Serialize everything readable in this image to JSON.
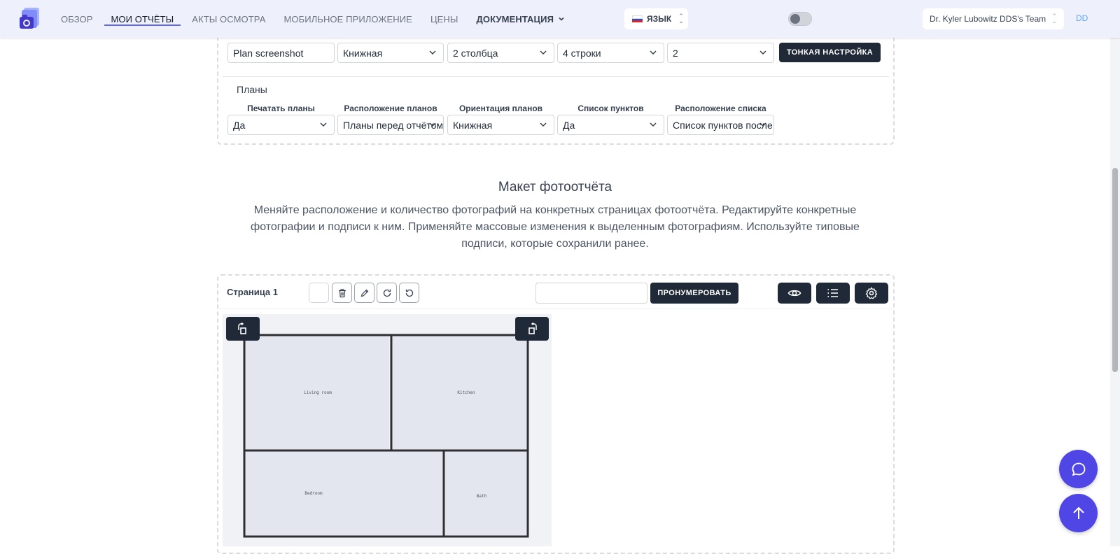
{
  "nav": {
    "links": [
      {
        "label": "ОБЗОР"
      },
      {
        "label": "МОИ ОТЧЁТЫ"
      },
      {
        "label": "АКТЫ ОСМОТРА"
      },
      {
        "label": "МОБИЛЬНОЕ ПРИЛОЖЕНИЕ"
      },
      {
        "label": "ЦЕНЫ"
      },
      {
        "label": "ДОКУМЕНТАЦИЯ"
      }
    ],
    "active": "МОИ ОТЧЁТЫ",
    "language_label": "ЯЗЫК",
    "team": "Dr. Kyler Lubowitz DDS's Team",
    "initials": "DD"
  },
  "settings": {
    "top_fields": [
      "Plan screenshot",
      "Книжная",
      "2 столбца",
      "4 строки",
      "2"
    ],
    "fine_tune_button": "ТОНКАЯ НАСТРОЙКА",
    "plans_section_title": "Планы",
    "plans_labels": [
      "Печатать планы",
      "Расположение планов",
      "Ориентация планов",
      "Список пунктов",
      "Расположение списка"
    ],
    "plans_values": [
      "Да",
      "Планы перед отчётом",
      "Книжная",
      "Да",
      "Список пунктов после"
    ]
  },
  "layout": {
    "heading": "Макет фотоотчёта",
    "description": "Меняйте расположение и количество фотографий на конкретных страницах фотоотчёта. Редактируйте конкретные фотографии и подписи к ним. Применяйте массовые изменения к выделенным фотографиям. Используйте типовые подписи, которые сохранили ранее.",
    "page_label": "Страница 1",
    "number_input_value": "",
    "number_button": "ПРОНУМЕРОВАТЬ",
    "rooms": [
      "Living room",
      "Kitchen",
      "Bedroom",
      "Bath"
    ]
  },
  "colors": {
    "accent": "#6366f1",
    "dark_button": "#1f2937",
    "fab": "#4f46e5",
    "nav_bg": "#eef1fb"
  },
  "icons": [
    "logo-camera-icon",
    "flag-ru-icon",
    "trash-icon",
    "pencil-icon",
    "rotate-cw-icon",
    "rotate-ccw-icon",
    "eye-icon",
    "list-icon",
    "gear-icon",
    "rotate-left-icon",
    "rotate-right-icon",
    "chat-icon",
    "arrow-up-icon"
  ]
}
